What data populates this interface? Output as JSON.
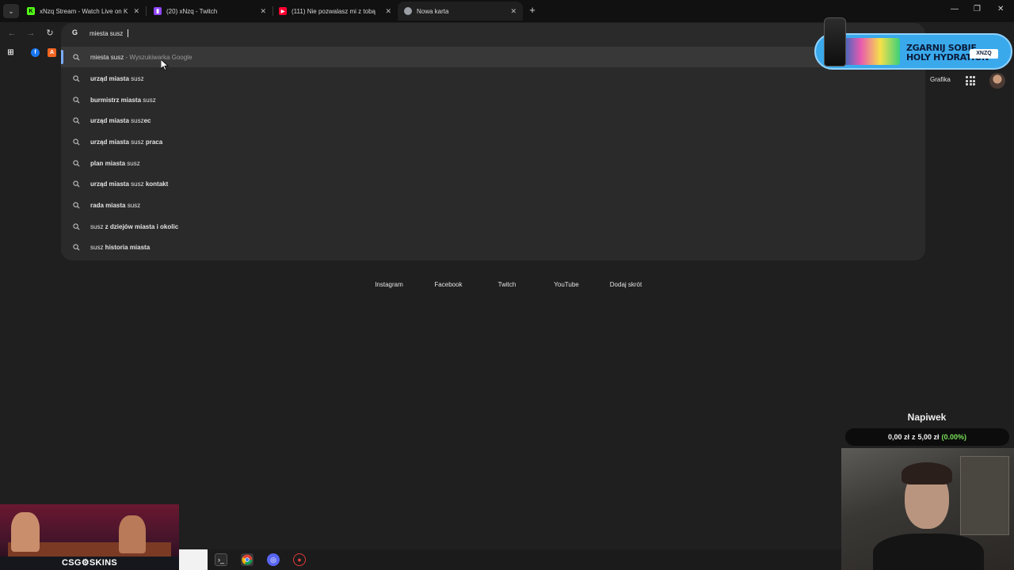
{
  "tabs": [
    {
      "title": "xNzq Stream - Watch Live on K",
      "favicon": "kick-icon",
      "color": "#53fc18",
      "active": false
    },
    {
      "title": "(20) xNzq - Twitch",
      "favicon": "twitch-icon",
      "color": "#9146ff",
      "active": false
    },
    {
      "title": "(111) Nie pozwalasz mi z tobą",
      "favicon": "youtube-icon",
      "color": "#ff0033",
      "active": false
    },
    {
      "title": "Nowa karta",
      "favicon": "chrome-icon",
      "color": "#9aa0a6",
      "active": true
    }
  ],
  "window_controls": {
    "minimize": "—",
    "restore": "❐",
    "close": "✕"
  },
  "omnibox": {
    "value": "miesta susz",
    "suggestions": [
      {
        "parts": [
          {
            "t": "miesta susz",
            "b": false
          },
          {
            "t": " - Wyszukiwarka Google",
            "b": false,
            "hint": true
          }
        ],
        "selected": true
      },
      {
        "parts": [
          {
            "t": "urząd miasta",
            "b": true
          },
          {
            "t": " susz",
            "b": false
          }
        ]
      },
      {
        "parts": [
          {
            "t": "burmistrz miasta",
            "b": true
          },
          {
            "t": " susz",
            "b": false
          }
        ]
      },
      {
        "parts": [
          {
            "t": "urząd miasta",
            "b": true
          },
          {
            "t": " susz",
            "b": false
          },
          {
            "t": "ec",
            "b": true
          }
        ]
      },
      {
        "parts": [
          {
            "t": "urząd miasta",
            "b": true
          },
          {
            "t": " susz ",
            "b": false
          },
          {
            "t": "praca",
            "b": true
          }
        ]
      },
      {
        "parts": [
          {
            "t": "plan miasta",
            "b": true
          },
          {
            "t": " susz",
            "b": false
          }
        ]
      },
      {
        "parts": [
          {
            "t": "urząd miasta",
            "b": true
          },
          {
            "t": " susz ",
            "b": false
          },
          {
            "t": "kontakt",
            "b": true
          }
        ]
      },
      {
        "parts": [
          {
            "t": "rada miasta",
            "b": true
          },
          {
            "t": " susz",
            "b": false
          }
        ]
      },
      {
        "parts": [
          {
            "t": "susz",
            "b": false
          },
          {
            "t": " z dziejów miasta i okolic",
            "b": true
          }
        ]
      },
      {
        "parts": [
          {
            "t": "susz",
            "b": false
          },
          {
            "t": " historia miasta",
            "b": true
          }
        ]
      }
    ]
  },
  "bookmarks": [
    {
      "icon": "apps-grid-icon",
      "color": "#d6d6d6"
    },
    {
      "icon": "facebook-icon",
      "color": "#1877f2"
    },
    {
      "icon": "bookmark-app-icon",
      "color": "#f26522"
    }
  ],
  "ntp": {
    "images_link": "Grafika",
    "shortcuts": [
      {
        "label": "Instagram",
        "color": "#e1306c"
      },
      {
        "label": "Facebook",
        "color": "#1877f2"
      },
      {
        "label": "Twitch",
        "color": "#9146ff"
      },
      {
        "label": "YouTube",
        "color": "#ff0033"
      },
      {
        "label": "Dodaj skrót",
        "color": "#3a3a3a"
      }
    ]
  },
  "overlay": {
    "ad": {
      "line1": "ZGARNIJ SOBIE",
      "line2": "HOLY HYDRATION",
      "code": "XNZQ"
    },
    "tip": {
      "title": "Napiwek",
      "current": "0,00 zł",
      "sep": "z",
      "goal": "5,00 zł",
      "percent": "(0.00%)",
      "progress": 0
    },
    "sponsor": {
      "brand": "CSG⚙SKINS"
    }
  },
  "taskbar": [
    {
      "icon": "terminal-icon",
      "color": "#2b2b2b"
    },
    {
      "icon": "chrome-icon",
      "color": "#4285f4"
    },
    {
      "icon": "discord-icon",
      "color": "#5865f2"
    },
    {
      "icon": "recorder-icon",
      "color": "#e23b3b"
    }
  ]
}
